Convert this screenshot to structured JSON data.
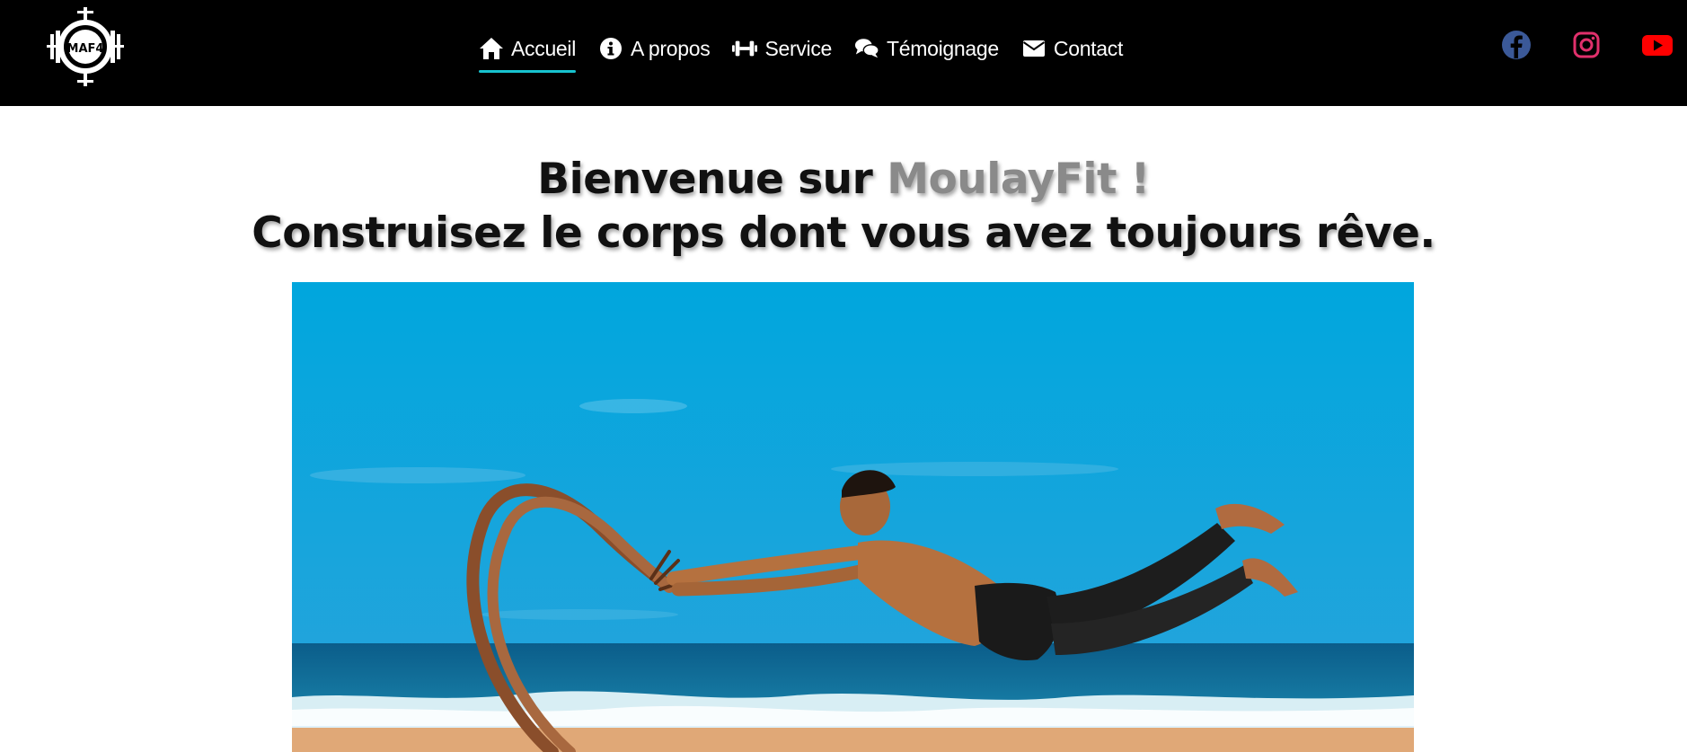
{
  "brand": {
    "logo_text": "MAF4"
  },
  "nav": {
    "items": [
      {
        "label": "Accueil",
        "icon": "home-icon",
        "active": true
      },
      {
        "label": "A propos",
        "icon": "info-icon",
        "active": false
      },
      {
        "label": "Service",
        "icon": "dumbbell-icon",
        "active": false
      },
      {
        "label": "Témoignage",
        "icon": "comments-icon",
        "active": false
      },
      {
        "label": "Contact",
        "icon": "envelope-icon",
        "active": false
      }
    ],
    "active_underline_color": "#17c3cf"
  },
  "socials": [
    {
      "name": "facebook-icon",
      "color": "#3b5998"
    },
    {
      "name": "instagram-icon",
      "color": "#e1306c"
    },
    {
      "name": "youtube-icon",
      "color": "#ff0000"
    }
  ],
  "hero": {
    "title_prefix": "Bienvenue sur ",
    "title_brand": "MoulayFit !",
    "subtitle": "Construisez le corps dont vous avez toujours rêve."
  }
}
